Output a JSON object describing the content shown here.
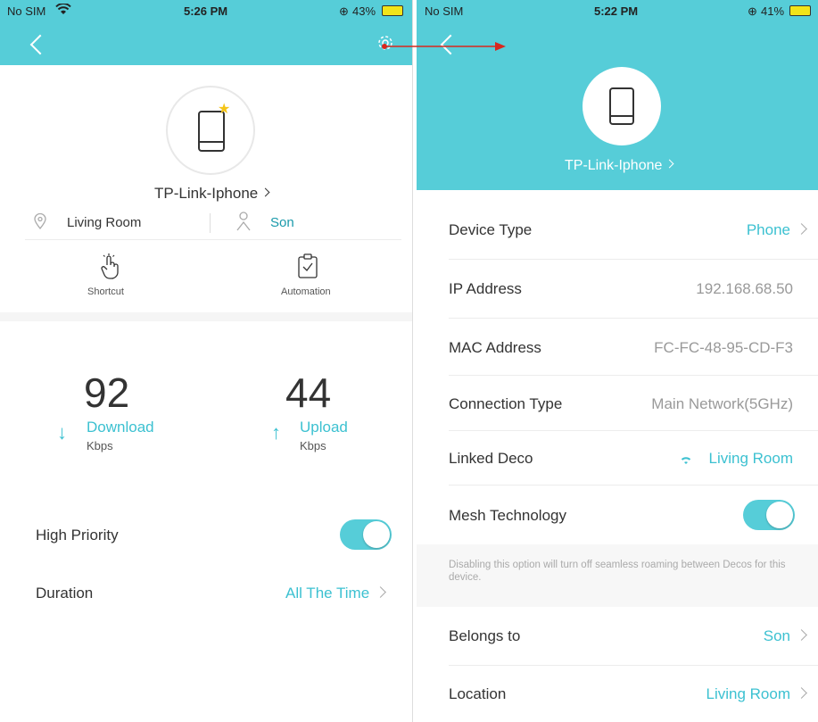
{
  "left": {
    "status": {
      "carrier": "No SIM",
      "time": "5:26 PM",
      "battery": "43%"
    },
    "device_name": "TP-Link-Iphone",
    "location": "Living Room",
    "owner": "Son",
    "actions": [
      {
        "label": "Shortcut"
      },
      {
        "label": "Automation"
      }
    ],
    "download": {
      "value": "92",
      "label": "Download",
      "unit": "Kbps"
    },
    "upload": {
      "value": "44",
      "label": "Upload",
      "unit": "Kbps"
    },
    "high_priority": {
      "label": "High Priority",
      "on": true
    },
    "duration": {
      "label": "Duration",
      "value": "All The Time"
    }
  },
  "right": {
    "status": {
      "carrier": "No SIM",
      "time": "5:22 PM",
      "battery": "41%"
    },
    "device_name": "TP-Link-Iphone",
    "rows": {
      "device_type": {
        "label": "Device Type",
        "value": "Phone"
      },
      "ip": {
        "label": "IP Address",
        "value": "192.168.68.50"
      },
      "mac": {
        "label": "MAC Address",
        "value": "FC-FC-48-95-CD-F3"
      },
      "conn": {
        "label": "Connection Type",
        "value": "Main Network(5GHz)"
      },
      "linked": {
        "label": "Linked Deco",
        "value": "Living Room"
      },
      "mesh": {
        "label": "Mesh Technology",
        "on": true
      },
      "belongs": {
        "label": "Belongs to",
        "value": "Son"
      },
      "location": {
        "label": "Location",
        "value": "Living Room"
      }
    },
    "mesh_note": "Disabling this option will turn off seamless roaming between Decos for this device."
  },
  "colors": {
    "accent": "#56cdd8",
    "arrow": "#d9281e",
    "star": "#f5c518"
  }
}
